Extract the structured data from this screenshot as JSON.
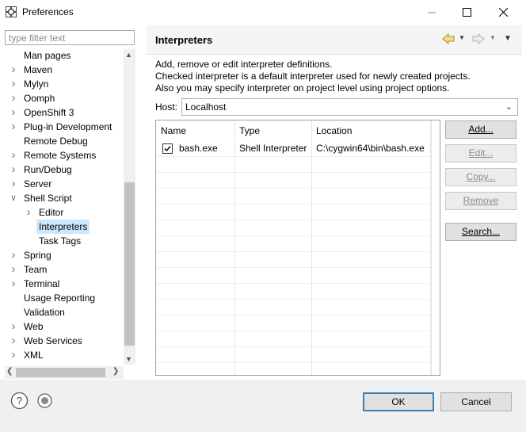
{
  "window": {
    "title": "Preferences"
  },
  "sidebar": {
    "filter_placeholder": "type filter text",
    "items": [
      {
        "label": "Man pages",
        "expandable": false,
        "depth": 0
      },
      {
        "label": "Maven",
        "expandable": true,
        "depth": 0
      },
      {
        "label": "Mylyn",
        "expandable": true,
        "depth": 0
      },
      {
        "label": "Oomph",
        "expandable": true,
        "depth": 0
      },
      {
        "label": "OpenShift 3",
        "expandable": true,
        "depth": 0
      },
      {
        "label": "Plug-in Development",
        "expandable": true,
        "depth": 0
      },
      {
        "label": "Remote Debug",
        "expandable": false,
        "depth": 0
      },
      {
        "label": "Remote Systems",
        "expandable": true,
        "depth": 0
      },
      {
        "label": "Run/Debug",
        "expandable": true,
        "depth": 0
      },
      {
        "label": "Server",
        "expandable": true,
        "depth": 0
      },
      {
        "label": "Shell Script",
        "expandable": true,
        "expanded": true,
        "depth": 0
      },
      {
        "label": "Editor",
        "expandable": true,
        "depth": 1
      },
      {
        "label": "Interpreters",
        "expandable": false,
        "depth": 1,
        "selected": true
      },
      {
        "label": "Task Tags",
        "expandable": false,
        "depth": 1
      },
      {
        "label": "Spring",
        "expandable": true,
        "depth": 0
      },
      {
        "label": "Team",
        "expandable": true,
        "depth": 0
      },
      {
        "label": "Terminal",
        "expandable": true,
        "depth": 0
      },
      {
        "label": "Usage Reporting",
        "expandable": false,
        "depth": 0
      },
      {
        "label": "Validation",
        "expandable": false,
        "depth": 0
      },
      {
        "label": "Web",
        "expandable": true,
        "depth": 0
      },
      {
        "label": "Web Services",
        "expandable": true,
        "depth": 0
      },
      {
        "label": "XML",
        "expandable": true,
        "depth": 0
      }
    ]
  },
  "page": {
    "title": "Interpreters",
    "description": [
      "Add, remove or edit interpreter definitions.",
      "Checked interpreter is a default interpreter used for newly created projects.",
      "Also you may specify interpreter on project level using project options."
    ],
    "host_label": "Host:",
    "host_value": "Localhost",
    "table": {
      "columns": [
        "Name",
        "Type",
        "Location"
      ],
      "rows": [
        {
          "checked": true,
          "name": "bash.exe",
          "type": "Shell Interpreter",
          "location": "C:\\cygwin64\\bin\\bash.exe"
        }
      ]
    },
    "buttons": {
      "add": "Add...",
      "edit": "Edit...",
      "copy": "Copy...",
      "remove": "Remove",
      "search": "Search..."
    }
  },
  "footer": {
    "ok": "OK",
    "cancel": "Cancel"
  },
  "colors": {
    "selection": "#cce8ff",
    "default_button_border": "#3c7fb1"
  }
}
